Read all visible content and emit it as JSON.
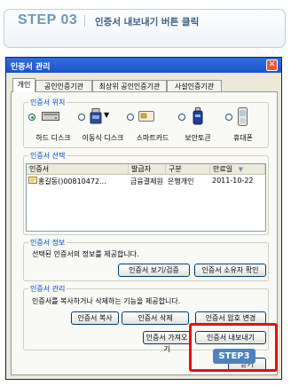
{
  "step": {
    "number": "STEP 03",
    "title": "인증서 내보내기 버튼 클릭"
  },
  "window": {
    "title": "인증서 관리",
    "close": "✕"
  },
  "tabs": [
    "개인",
    "공인인증기관",
    "최상위 공인인증기관",
    "사설인증기관"
  ],
  "location": {
    "label": "인증서 위치",
    "devices": [
      {
        "label": "하드 디스크",
        "icon": "hard-disk-icon",
        "selected": true
      },
      {
        "label": "이동식 디스크",
        "icon": "removable-disk-icon",
        "selected": false,
        "dropdown": "▼"
      },
      {
        "label": "스마트카드",
        "icon": "smart-card-icon",
        "selected": false
      },
      {
        "label": "보안토큰",
        "icon": "security-token-icon",
        "selected": false
      },
      {
        "label": "휴대폰",
        "icon": "mobile-phone-icon",
        "selected": false
      }
    ]
  },
  "selection": {
    "label": "인증서 선택",
    "columns": [
      "인증서",
      "발급자",
      "구분",
      "만료일"
    ],
    "sort_indicator": "▼",
    "rows": [
      {
        "name": "홍길동()00810472...",
        "issuer": "금융결제원",
        "type": "은행개인",
        "expiry": "2011-10-22"
      }
    ]
  },
  "info": {
    "label": "인증서 정보",
    "text": "선택된 인증서의 정보를 제공합니다.",
    "buttons": {
      "view": "인증서 보기/검증",
      "owner": "인증서 소유자 확인"
    }
  },
  "manage": {
    "label": "인증서 관리",
    "text": "인증서를 복사하거나 삭제하는 기능을 제공합니다.",
    "buttons": {
      "copy": "인증서 복사",
      "delete": "인증서 삭제",
      "password": "인증서 암호 변경",
      "import": "인증서 가져오기",
      "export": "인증서 내보내기"
    }
  },
  "callout": {
    "tag": "STEP3",
    "color": "#e10f14"
  },
  "footer": {
    "close": "닫기"
  }
}
